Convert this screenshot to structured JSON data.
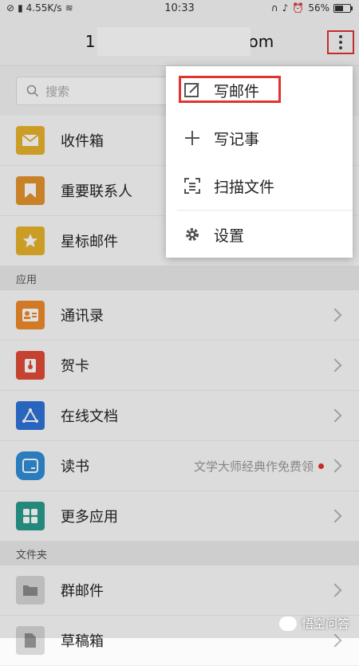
{
  "status_bar": {
    "network": "4.55K/s",
    "time": "10:33",
    "battery": "56%",
    "battery_level": 0.56
  },
  "header": {
    "title_left": "1",
    "title_right": "om"
  },
  "search": {
    "placeholder": "搜索"
  },
  "mailboxes": [
    {
      "label": "收件箱",
      "icon": "inbox-icon",
      "color": "#e8b32d"
    },
    {
      "label": "重要联系人",
      "icon": "bookmark-icon",
      "color": "#e4932d"
    },
    {
      "label": "星标邮件",
      "icon": "star-icon",
      "color": "#e8b32d"
    }
  ],
  "apps_section": {
    "title": "应用"
  },
  "apps": [
    {
      "label": "通讯录",
      "icon": "contacts-icon",
      "color": "#ef8a2b",
      "hint": ""
    },
    {
      "label": "贺卡",
      "icon": "greeting-card-icon",
      "color": "#e24c37",
      "hint": ""
    },
    {
      "label": "在线文档",
      "icon": "online-doc-icon",
      "color": "#2f73d8",
      "hint": ""
    },
    {
      "label": "读书",
      "icon": "book-icon",
      "color": "#2f8ed8",
      "hint": "文学大师经典作免费领"
    },
    {
      "label": "更多应用",
      "icon": "apps-grid-icon",
      "color": "#2a9b8f",
      "hint": ""
    }
  ],
  "folders_section": {
    "title": "文件夹"
  },
  "folders": [
    {
      "label": "群邮件",
      "icon": "folder-icon",
      "color": "#cfcfcf"
    },
    {
      "label": "草稿箱",
      "icon": "draft-icon",
      "color": "#cfcfcf"
    }
  ],
  "menu": {
    "items": [
      {
        "label": "写邮件",
        "icon": "compose-icon"
      },
      {
        "label": "写记事",
        "icon": "plus-icon"
      },
      {
        "label": "扫描文件",
        "icon": "scan-icon"
      },
      {
        "label": "设置",
        "icon": "gear-icon"
      }
    ]
  },
  "watermark": {
    "text": "悟空问答"
  }
}
